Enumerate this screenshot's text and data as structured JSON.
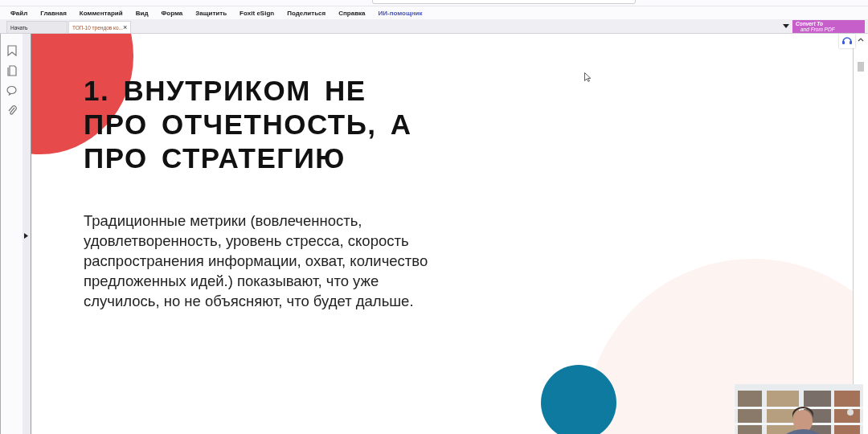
{
  "menu": [
    "Файл",
    "Главная",
    "Комментарий",
    "Вид",
    "Форма",
    "Защитить",
    "Foxit eSign",
    "Поделиться",
    "Справка",
    "ИИ-помощник"
  ],
  "tabs": [
    {
      "label": "Начать",
      "selected": false,
      "closable": false
    },
    {
      "label": "ТОП-10 трендов ко...",
      "selected": true,
      "closable": true
    }
  ],
  "tab_close": "×",
  "promo": {
    "line1": "Convert To",
    "line2": "and From PDF"
  },
  "slide": {
    "heading": "1. ВНУТРИКОМ НЕ ПРО ОТЧЕТНОСТЬ, А ПРО СТРАТЕГИЮ",
    "body": "Традиционные метрики (вовлеченность, удовлетворенность, уровень стресса, скорость распространения информации, охват, количество предложенных идей.) показывают, что уже случилось, но не объясняют, что будет дальше."
  }
}
